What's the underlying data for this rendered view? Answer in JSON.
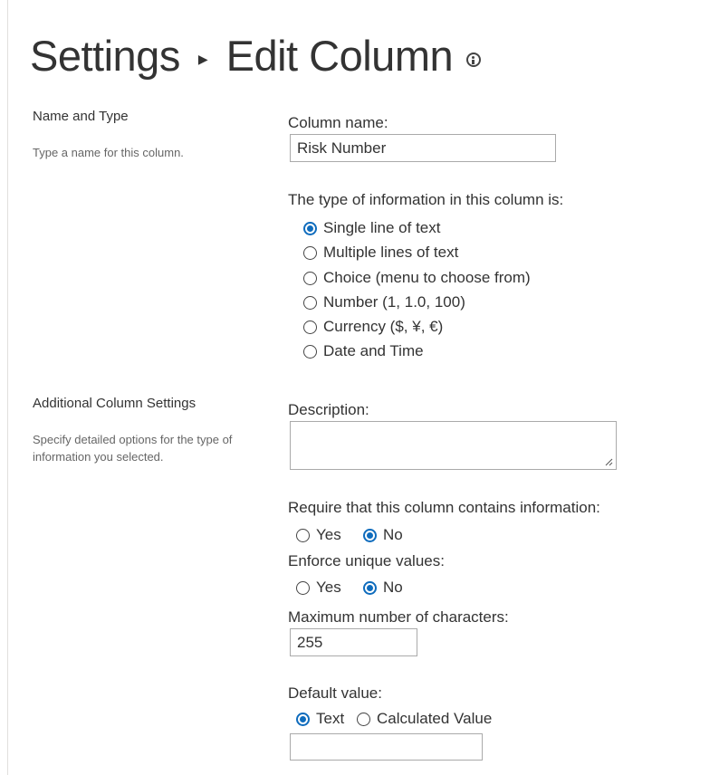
{
  "header": {
    "crumb": "Settings",
    "title": "Edit Column",
    "info_icon": "info-icon"
  },
  "name_type": {
    "title": "Name and Type",
    "desc": "Type a name for this column.",
    "column_name_label": "Column name:",
    "column_name_value": "Risk Number",
    "type_label": "The type of information in this column is:",
    "types": [
      {
        "label": "Single line of text",
        "checked": true
      },
      {
        "label": "Multiple lines of text",
        "checked": false
      },
      {
        "label": "Choice (menu to choose from)",
        "checked": false
      },
      {
        "label": "Number (1, 1.0, 100)",
        "checked": false
      },
      {
        "label": "Currency ($, ¥, €)",
        "checked": false
      },
      {
        "label": "Date and Time",
        "checked": false
      }
    ]
  },
  "additional": {
    "title": "Additional Column Settings",
    "desc": "Specify detailed options for the type of information you selected.",
    "description_label": "Description:",
    "description_value": "",
    "require_label": "Require that this column contains information:",
    "require_options": [
      {
        "label": "Yes",
        "checked": false
      },
      {
        "label": "No",
        "checked": true
      }
    ],
    "unique_label": "Enforce unique values:",
    "unique_options": [
      {
        "label": "Yes",
        "checked": false
      },
      {
        "label": "No",
        "checked": true
      }
    ],
    "maxchars_label": "Maximum number of characters:",
    "maxchars_value": "255",
    "default_label": "Default value:",
    "default_options": [
      {
        "label": "Text",
        "checked": true
      },
      {
        "label": "Calculated Value",
        "checked": false
      }
    ],
    "default_value": ""
  },
  "colors": {
    "accent": "#0f6cbd",
    "text": "#333333",
    "muted": "#666666",
    "border": "#aaaaaa"
  }
}
